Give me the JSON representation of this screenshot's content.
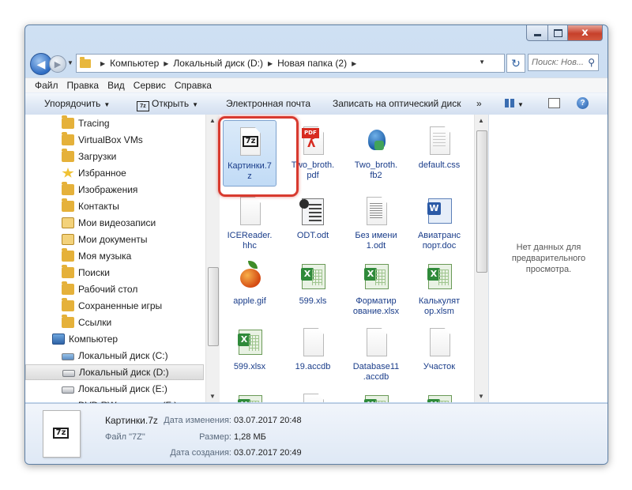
{
  "window": {
    "caption": {
      "minimize": "—",
      "maximize": "□",
      "close": "x"
    }
  },
  "address": {
    "crumbs": [
      "Компьютер",
      "Локальный диск (D:)",
      "Новая папка (2)"
    ],
    "search_placeholder": "Поиск: Нов...",
    "refresh_glyph": "↻"
  },
  "menu": [
    "Файл",
    "Правка",
    "Вид",
    "Сервис",
    "Справка"
  ],
  "commands": {
    "organize": "Упорядочить",
    "open": "Открыть",
    "email": "Электронная почта",
    "burn": "Записать на оптический диск",
    "more": "»"
  },
  "nav": [
    {
      "label": "Tracing",
      "icon": "folder-icon"
    },
    {
      "label": "VirtualBox VMs",
      "icon": "folder-icon"
    },
    {
      "label": "Загрузки",
      "icon": "downloads-folder-icon"
    },
    {
      "label": "Избранное",
      "icon": "favorites-folder-icon"
    },
    {
      "label": "Изображения",
      "icon": "pictures-folder-icon"
    },
    {
      "label": "Контакты",
      "icon": "contacts-folder-icon"
    },
    {
      "label": "Мои видеозаписи",
      "icon": "videos-folder-icon"
    },
    {
      "label": "Мои документы",
      "icon": "documents-folder-icon"
    },
    {
      "label": "Моя музыка",
      "icon": "music-folder-icon"
    },
    {
      "label": "Поиски",
      "icon": "searches-folder-icon"
    },
    {
      "label": "Рабочий стол",
      "icon": "desktop-folder-icon"
    },
    {
      "label": "Сохраненные игры",
      "icon": "games-folder-icon"
    },
    {
      "label": "Ссылки",
      "icon": "links-folder-icon"
    },
    {
      "label": "Компьютер",
      "icon": "computer-icon"
    },
    {
      "label": "Локальный диск (C:)",
      "icon": "system-drive-icon"
    },
    {
      "label": "Локальный диск (D:)",
      "icon": "drive-icon",
      "selected": true
    },
    {
      "label": "Локальный диск (E:)",
      "icon": "drive-icon"
    },
    {
      "label": "DVD RW дисковод (F:)",
      "icon": "dvd-drive-icon"
    }
  ],
  "files": [
    {
      "name": "Картинки.7z",
      "type": "7z",
      "selected": true
    },
    {
      "name": "Two_broth.pdf",
      "type": "pdf"
    },
    {
      "name": "Two_broth.fb2",
      "type": "fb2"
    },
    {
      "name": "default.css",
      "type": "text"
    },
    {
      "name": "ICEReader.hhc",
      "type": "blank"
    },
    {
      "name": "ODT.odt",
      "type": "odt"
    },
    {
      "name": "Без имени 1.odt",
      "type": "odt-thumb"
    },
    {
      "name": "Авиатранспорт.doc",
      "type": "word"
    },
    {
      "name": "apple.gif",
      "type": "image"
    },
    {
      "name": "599.xls",
      "type": "excel"
    },
    {
      "name": "Форматирование.xlsx",
      "type": "excel"
    },
    {
      "name": "Калькулятор.xlsm",
      "type": "excel-macro"
    },
    {
      "name": "599.xlsx",
      "type": "excel"
    },
    {
      "name": "19.accdb",
      "type": "blank"
    },
    {
      "name": "Database11.accdb",
      "type": "blank"
    },
    {
      "name": "Участок",
      "type": "blank"
    },
    {
      "name": "",
      "type": "excel"
    },
    {
      "name": "",
      "type": "blank"
    },
    {
      "name": "",
      "type": "excel"
    },
    {
      "name": "",
      "type": "excel"
    }
  ],
  "file_labels": {
    "f0": "Картинки.7\nz",
    "f1": "Two_broth.\npdf",
    "f2": "Two_broth.\nfb2",
    "f3": "default.css",
    "f4": "ICEReader.\nhhc",
    "f5": "ODT.odt",
    "f6": "Без имени\n1.odt",
    "f7": "Авиатранс\nпорт.doc",
    "f8": "apple.gif",
    "f9": "599.xls",
    "f10": "Форматир\nование.xlsx",
    "f11": "Калькулят\nор.xlsm",
    "f12": "599.xlsx",
    "f13": "19.accdb",
    "f14": "Database11\n.accdb",
    "f15": "Участок"
  },
  "preview": {
    "message": "Нет данных для предварительного просмотра."
  },
  "details": {
    "name": "Картинки.7z",
    "file_type": "Файл \"7Z\"",
    "modified_label": "Дата изменения:",
    "modified_value": "03.07.2017 20:48",
    "size_label": "Размер:",
    "size_value": "1,28 МБ",
    "created_label": "Дата создания:",
    "created_value": "03.07.2017 20:49",
    "icon_badge": "7z"
  },
  "colors": {
    "highlight": "#d83a2f",
    "link_text": "#1a3d8a",
    "excel_green": "#2f8a3a"
  }
}
